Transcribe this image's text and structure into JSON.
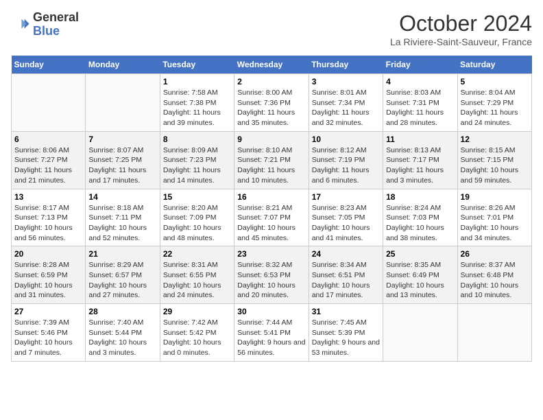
{
  "header": {
    "logo_line1": "General",
    "logo_line2": "Blue",
    "month_title": "October 2024",
    "location": "La Riviere-Saint-Sauveur, France"
  },
  "days_of_week": [
    "Sunday",
    "Monday",
    "Tuesday",
    "Wednesday",
    "Thursday",
    "Friday",
    "Saturday"
  ],
  "weeks": [
    [
      {
        "day": "",
        "info": ""
      },
      {
        "day": "",
        "info": ""
      },
      {
        "day": "1",
        "info": "Sunrise: 7:58 AM\nSunset: 7:38 PM\nDaylight: 11 hours and 39 minutes."
      },
      {
        "day": "2",
        "info": "Sunrise: 8:00 AM\nSunset: 7:36 PM\nDaylight: 11 hours and 35 minutes."
      },
      {
        "day": "3",
        "info": "Sunrise: 8:01 AM\nSunset: 7:34 PM\nDaylight: 11 hours and 32 minutes."
      },
      {
        "day": "4",
        "info": "Sunrise: 8:03 AM\nSunset: 7:31 PM\nDaylight: 11 hours and 28 minutes."
      },
      {
        "day": "5",
        "info": "Sunrise: 8:04 AM\nSunset: 7:29 PM\nDaylight: 11 hours and 24 minutes."
      }
    ],
    [
      {
        "day": "6",
        "info": "Sunrise: 8:06 AM\nSunset: 7:27 PM\nDaylight: 11 hours and 21 minutes."
      },
      {
        "day": "7",
        "info": "Sunrise: 8:07 AM\nSunset: 7:25 PM\nDaylight: 11 hours and 17 minutes."
      },
      {
        "day": "8",
        "info": "Sunrise: 8:09 AM\nSunset: 7:23 PM\nDaylight: 11 hours and 14 minutes."
      },
      {
        "day": "9",
        "info": "Sunrise: 8:10 AM\nSunset: 7:21 PM\nDaylight: 11 hours and 10 minutes."
      },
      {
        "day": "10",
        "info": "Sunrise: 8:12 AM\nSunset: 7:19 PM\nDaylight: 11 hours and 6 minutes."
      },
      {
        "day": "11",
        "info": "Sunrise: 8:13 AM\nSunset: 7:17 PM\nDaylight: 11 hours and 3 minutes."
      },
      {
        "day": "12",
        "info": "Sunrise: 8:15 AM\nSunset: 7:15 PM\nDaylight: 10 hours and 59 minutes."
      }
    ],
    [
      {
        "day": "13",
        "info": "Sunrise: 8:17 AM\nSunset: 7:13 PM\nDaylight: 10 hours and 56 minutes."
      },
      {
        "day": "14",
        "info": "Sunrise: 8:18 AM\nSunset: 7:11 PM\nDaylight: 10 hours and 52 minutes."
      },
      {
        "day": "15",
        "info": "Sunrise: 8:20 AM\nSunset: 7:09 PM\nDaylight: 10 hours and 48 minutes."
      },
      {
        "day": "16",
        "info": "Sunrise: 8:21 AM\nSunset: 7:07 PM\nDaylight: 10 hours and 45 minutes."
      },
      {
        "day": "17",
        "info": "Sunrise: 8:23 AM\nSunset: 7:05 PM\nDaylight: 10 hours and 41 minutes."
      },
      {
        "day": "18",
        "info": "Sunrise: 8:24 AM\nSunset: 7:03 PM\nDaylight: 10 hours and 38 minutes."
      },
      {
        "day": "19",
        "info": "Sunrise: 8:26 AM\nSunset: 7:01 PM\nDaylight: 10 hours and 34 minutes."
      }
    ],
    [
      {
        "day": "20",
        "info": "Sunrise: 8:28 AM\nSunset: 6:59 PM\nDaylight: 10 hours and 31 minutes."
      },
      {
        "day": "21",
        "info": "Sunrise: 8:29 AM\nSunset: 6:57 PM\nDaylight: 10 hours and 27 minutes."
      },
      {
        "day": "22",
        "info": "Sunrise: 8:31 AM\nSunset: 6:55 PM\nDaylight: 10 hours and 24 minutes."
      },
      {
        "day": "23",
        "info": "Sunrise: 8:32 AM\nSunset: 6:53 PM\nDaylight: 10 hours and 20 minutes."
      },
      {
        "day": "24",
        "info": "Sunrise: 8:34 AM\nSunset: 6:51 PM\nDaylight: 10 hours and 17 minutes."
      },
      {
        "day": "25",
        "info": "Sunrise: 8:35 AM\nSunset: 6:49 PM\nDaylight: 10 hours and 13 minutes."
      },
      {
        "day": "26",
        "info": "Sunrise: 8:37 AM\nSunset: 6:48 PM\nDaylight: 10 hours and 10 minutes."
      }
    ],
    [
      {
        "day": "27",
        "info": "Sunrise: 7:39 AM\nSunset: 5:46 PM\nDaylight: 10 hours and 7 minutes."
      },
      {
        "day": "28",
        "info": "Sunrise: 7:40 AM\nSunset: 5:44 PM\nDaylight: 10 hours and 3 minutes."
      },
      {
        "day": "29",
        "info": "Sunrise: 7:42 AM\nSunset: 5:42 PM\nDaylight: 10 hours and 0 minutes."
      },
      {
        "day": "30",
        "info": "Sunrise: 7:44 AM\nSunset: 5:41 PM\nDaylight: 9 hours and 56 minutes."
      },
      {
        "day": "31",
        "info": "Sunrise: 7:45 AM\nSunset: 5:39 PM\nDaylight: 9 hours and 53 minutes."
      },
      {
        "day": "",
        "info": ""
      },
      {
        "day": "",
        "info": ""
      }
    ]
  ]
}
